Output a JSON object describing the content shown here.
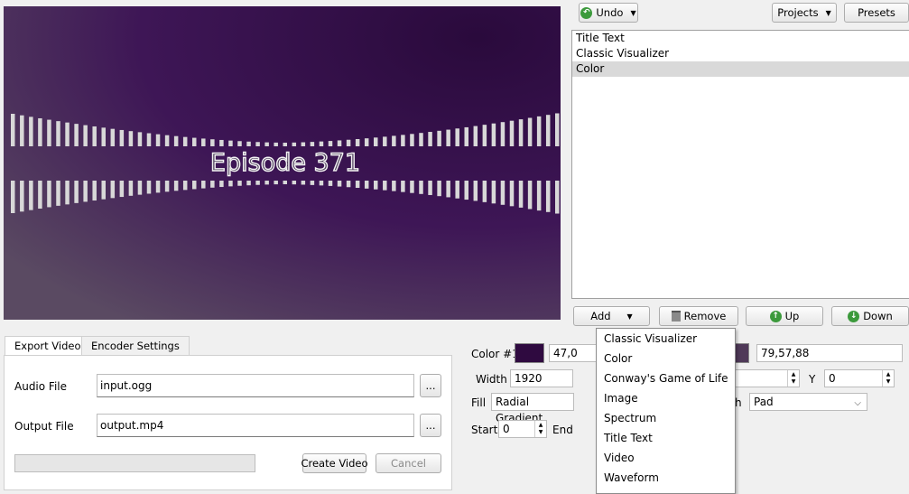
{
  "preview": {
    "episode_text": "Episode 371",
    "background_color": "#3b1350",
    "bar_color": "#d8d8d8"
  },
  "toolbar": {
    "undo_label": "Undo",
    "projects_label": "Projects",
    "presets_label": "Presets"
  },
  "layers": [
    {
      "label": "Title Text",
      "selected": false
    },
    {
      "label": "Classic Visualizer",
      "selected": false
    },
    {
      "label": "Color",
      "selected": true
    }
  ],
  "layer_buttons": {
    "add": "Add",
    "remove": "Remove",
    "up": "Up",
    "down": "Down"
  },
  "tabs": [
    {
      "label": "Export Video",
      "active": true
    },
    {
      "label": "Encoder Settings",
      "active": false
    }
  ],
  "export": {
    "audio_label": "Audio File",
    "audio_value": "input.ogg",
    "output_label": "Output File",
    "output_value": "output.mp4",
    "browse_label": "...",
    "create_label": "Create Video",
    "cancel_label": "Cancel",
    "progress": 0
  },
  "properties": {
    "color1_label": "Color #1",
    "color1_swatch": "#2f0a40",
    "color1_value": "47,0",
    "color2_swatch": "#4f3958",
    "color2_value": "79,57,88",
    "width_label": "Width",
    "width_value": "1920",
    "y_label": "Y",
    "y_value": "0",
    "fill_label": "Fill",
    "fill_value": "Radial Gradient",
    "spread_label_partial": "h",
    "spread_value": "Pad",
    "start_label": "Start",
    "start_value": "0",
    "end_label": "End"
  },
  "add_menu": [
    "Classic Visualizer",
    "Color",
    "Conway's Game of Life",
    "Image",
    "Spectrum",
    "Title Text",
    "Video",
    "Waveform"
  ]
}
